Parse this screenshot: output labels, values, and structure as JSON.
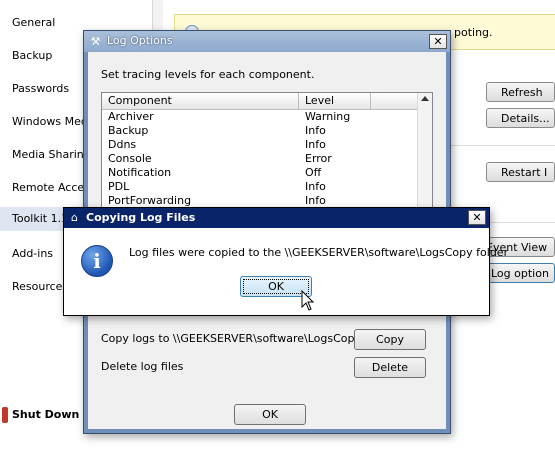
{
  "sidebar": {
    "items": [
      {
        "label": "General"
      },
      {
        "label": "Backup"
      },
      {
        "label": "Passwords"
      },
      {
        "label": "Windows Med"
      },
      {
        "label": "Media Sharing"
      },
      {
        "label": "Remote Acces"
      },
      {
        "label": "Toolkit 1.1"
      },
      {
        "label": "Add-ins"
      },
      {
        "label": "Resources"
      }
    ],
    "shutdown_label": "Shut Down"
  },
  "background": {
    "info_text": "poting.",
    "buttons": {
      "refresh": "Refresh",
      "details": "Details...",
      "restart": "Restart I",
      "event_viewer": "Event View",
      "log_options": "Log option"
    }
  },
  "log_options": {
    "title": "Log Options",
    "close_glyph": "✕",
    "instruction": "Set tracing levels for each component.",
    "columns": {
      "component": "Component",
      "level": "Level"
    },
    "rows": [
      {
        "component": "Archiver",
        "level": "Warning"
      },
      {
        "component": "Backup",
        "level": "Info"
      },
      {
        "component": "Ddns",
        "level": "Info"
      },
      {
        "component": "Console",
        "level": "Error"
      },
      {
        "component": "Notification",
        "level": "Off"
      },
      {
        "component": "PDL",
        "level": "Info"
      },
      {
        "component": "PortForwarding",
        "level": "Info"
      }
    ],
    "copy_text": "Copy logs to \\\\GEEKSERVER\\software\\LogsCopy",
    "copy_button": "Copy",
    "delete_text": "Delete log files",
    "delete_button": "Delete",
    "ok_button": "OK"
  },
  "copy_dialog": {
    "title": "Copying Log Files",
    "close_glyph": "✕",
    "icon_glyph": "i",
    "message": "Log files were copied to the \\\\GEEKSERVER\\software\\LogsCopy folder",
    "ok_button": "OK"
  }
}
